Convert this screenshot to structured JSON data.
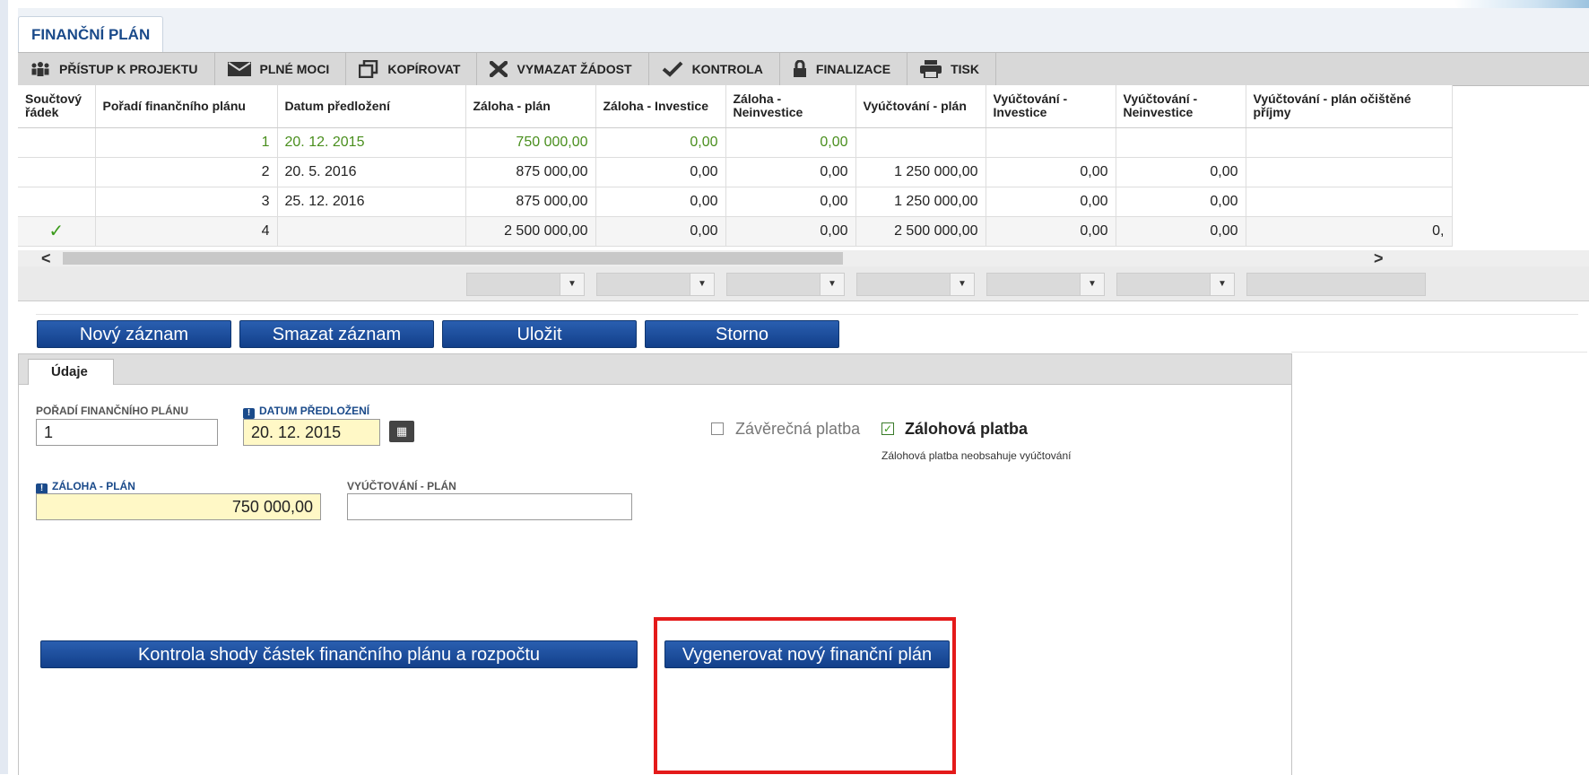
{
  "page": {
    "title": "FINANČNÍ PLÁN"
  },
  "toolbar": {
    "items": [
      {
        "label": "PŘÍSTUP K PROJEKTU",
        "icon": "people-icon"
      },
      {
        "label": "PLNÉ MOCI",
        "icon": "envelope-icon"
      },
      {
        "label": "KOPÍROVAT",
        "icon": "copy-icon"
      },
      {
        "label": "VYMAZAT ŽÁDOST",
        "icon": "delete-x-icon"
      },
      {
        "label": "KONTROLA",
        "icon": "checkmark-icon"
      },
      {
        "label": "FINALIZACE",
        "icon": "lock-icon"
      },
      {
        "label": "TISK",
        "icon": "printer-icon"
      }
    ]
  },
  "table": {
    "headers": [
      "Součtový řádek",
      "Pořadí finančního plánu",
      "Datum předložení",
      "Záloha - plán",
      "Záloha - Investice",
      "Záloha - Neinvestice",
      "Vyúčtování - plán",
      "Vyúčtování - Investice",
      "Vyúčtování - Neinvestice",
      "Vyúčtování - plán očištěné příjmy"
    ],
    "rows": [
      [
        "",
        "1",
        "20. 12. 2015",
        "750 000,00",
        "0,00",
        "0,00",
        "",
        "",
        "",
        ""
      ],
      [
        "",
        "2",
        "20. 5. 2016",
        "875 000,00",
        "0,00",
        "0,00",
        "1 250 000,00",
        "0,00",
        "0,00",
        ""
      ],
      [
        "",
        "3",
        "25. 12. 2016",
        "875 000,00",
        "0,00",
        "0,00",
        "1 250 000,00",
        "0,00",
        "0,00",
        ""
      ],
      [
        "",
        "4",
        "",
        "2 500 000,00",
        "0,00",
        "0,00",
        "2 500 000,00",
        "0,00",
        "0,00",
        "0,"
      ]
    ],
    "sum_row_checkmark": "✓",
    "selected_row_color": "#4a8f1e"
  },
  "buttons": {
    "new_record": "Nový záznam",
    "delete_record": "Smazat záznam",
    "save": "Uložit",
    "cancel": "Storno",
    "check_amounts": "Kontrola shody částek finančního plánu a rozpočtu",
    "generate_plan": "Vygenerovat nový finanční plán"
  },
  "form": {
    "tab_label": "Údaje",
    "order_label": "POŘADÍ FINANČNÍHO PLÁNU",
    "order_value": "1",
    "date_label": "DATUM PŘEDLOŽENÍ",
    "date_value": "20. 12. 2015",
    "advance_label": "ZÁLOHA - PLÁN",
    "advance_value": "750 000,00",
    "billing_label": "VYÚČTOVÁNÍ - PLÁN",
    "billing_value": "",
    "final_payment_label": "Závěrečná platba",
    "final_payment_checked": false,
    "advance_payment_label": "Zálohová platba",
    "advance_payment_checked": true,
    "advance_payment_note": "Zálohová platba neobsahuje vyúčtování"
  },
  "colors": {
    "brand": "#1a4a8a",
    "button": "#1f4f9c",
    "highlight": "#e41a1a",
    "required_field": "#fff8c6"
  }
}
